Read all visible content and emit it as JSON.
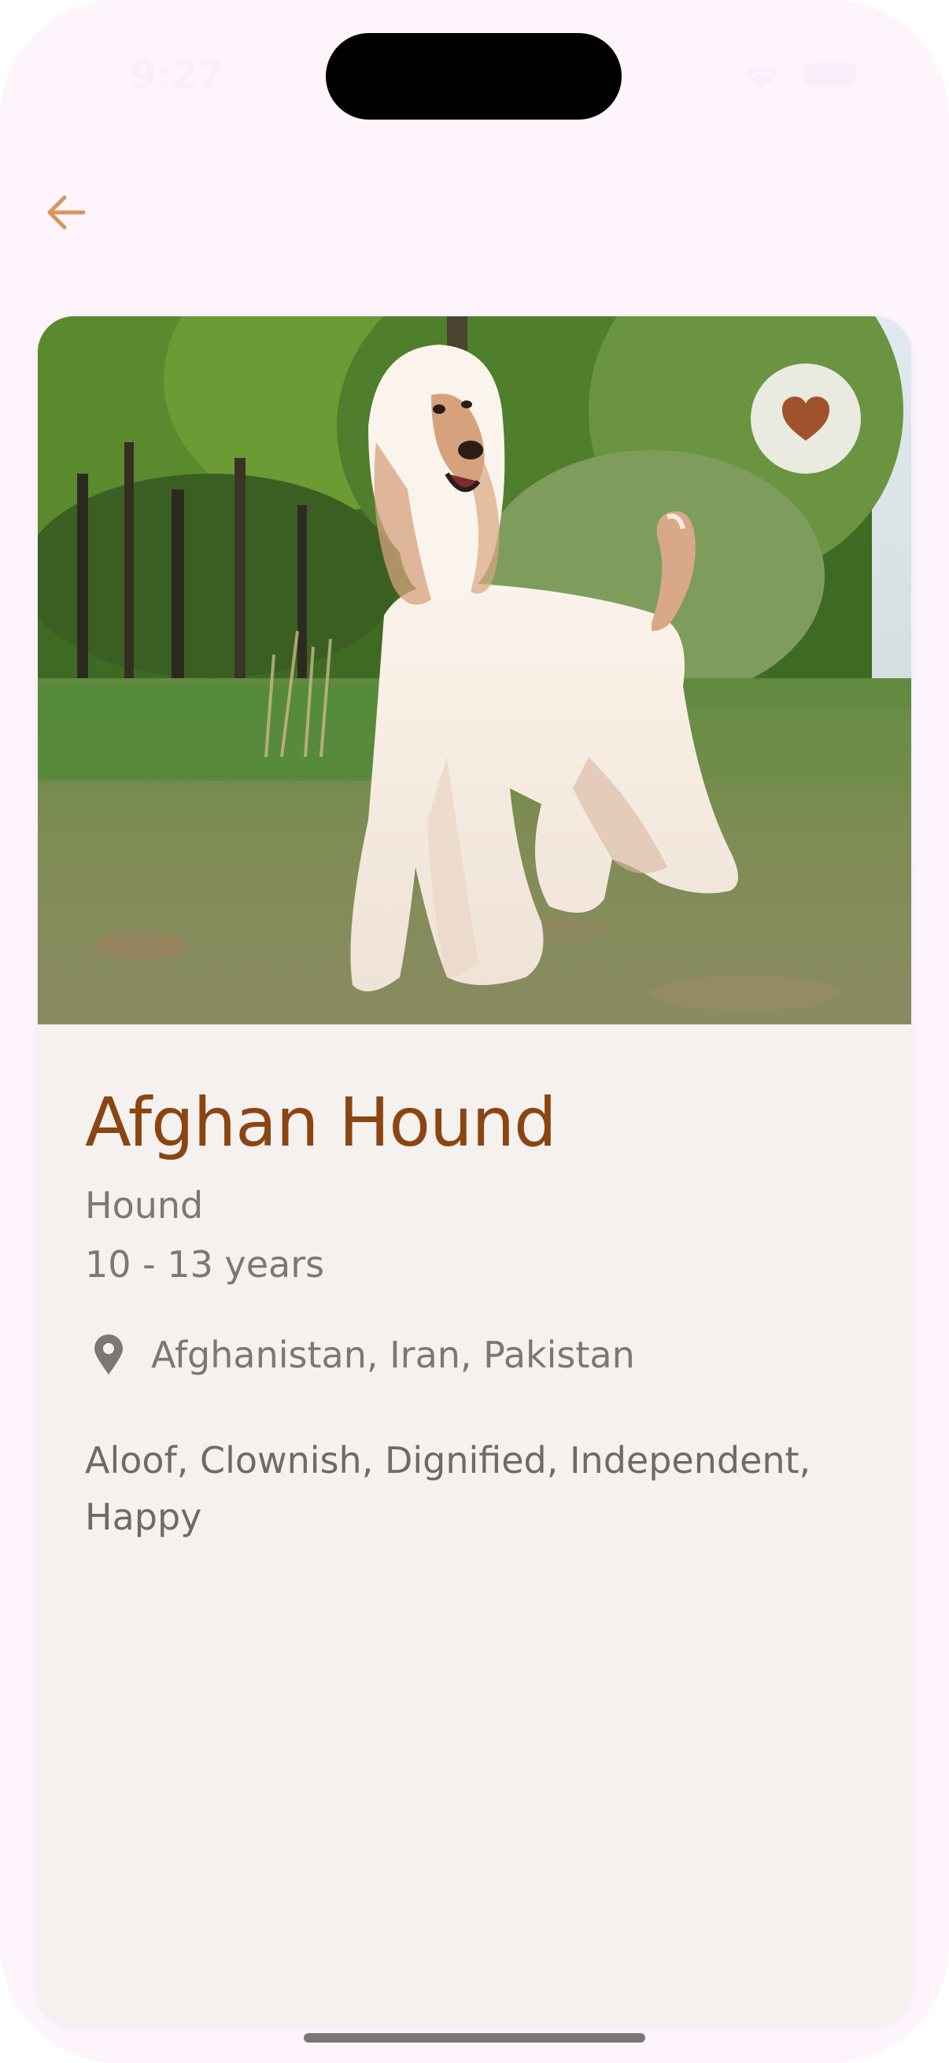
{
  "status_bar": {
    "time": "9:27"
  },
  "navigation": {
    "back_icon": "arrow-left-icon",
    "accent_color": "#d9955f"
  },
  "photo": {
    "subject": "dog-photo"
  },
  "favorite": {
    "icon": "heart-icon",
    "color": "#a0522d"
  },
  "breed": {
    "name": "Afghan Hound",
    "group": "Hound",
    "life_span": "10 - 13 years",
    "origin": "Afghanistan, Iran, Pakistan",
    "temperament": "Aloof, Clownish, Dignified, Independent, Happy"
  },
  "colors": {
    "title": "#8b4513",
    "secondary_text": "#7b7775",
    "card_background": "#f4f1ef",
    "screen_background": "#fdf4fc"
  }
}
